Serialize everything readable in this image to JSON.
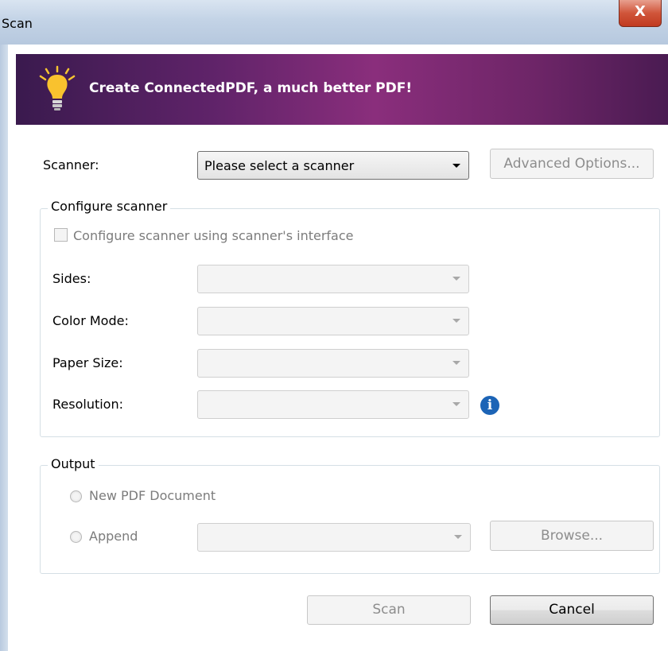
{
  "window": {
    "title": "Scan",
    "close_glyph": "X"
  },
  "banner": {
    "text": "Create ConnectedPDF, a much better PDF!",
    "icon": "lightbulb-icon"
  },
  "scanner": {
    "label": "Scanner:",
    "selected": "Please select a scanner",
    "advanced_label": "Advanced Options..."
  },
  "configure": {
    "group_title": "Configure scanner",
    "checkbox_label": "Configure scanner using scanner's interface",
    "sides_label": "Sides:",
    "color_mode_label": "Color Mode:",
    "paper_size_label": "Paper Size:",
    "resolution_label": "Resolution:",
    "info_glyph": "i"
  },
  "output": {
    "group_title": "Output",
    "new_pdf_label": "New PDF Document",
    "append_label": "Append",
    "browse_label": "Browse..."
  },
  "actions": {
    "scan_label": "Scan",
    "cancel_label": "Cancel"
  },
  "colors": {
    "banner_start": "#3a1a4e",
    "banner_mid": "#8a2e7c",
    "info_blue": "#1c64b6",
    "close_red": "#c13a20"
  }
}
